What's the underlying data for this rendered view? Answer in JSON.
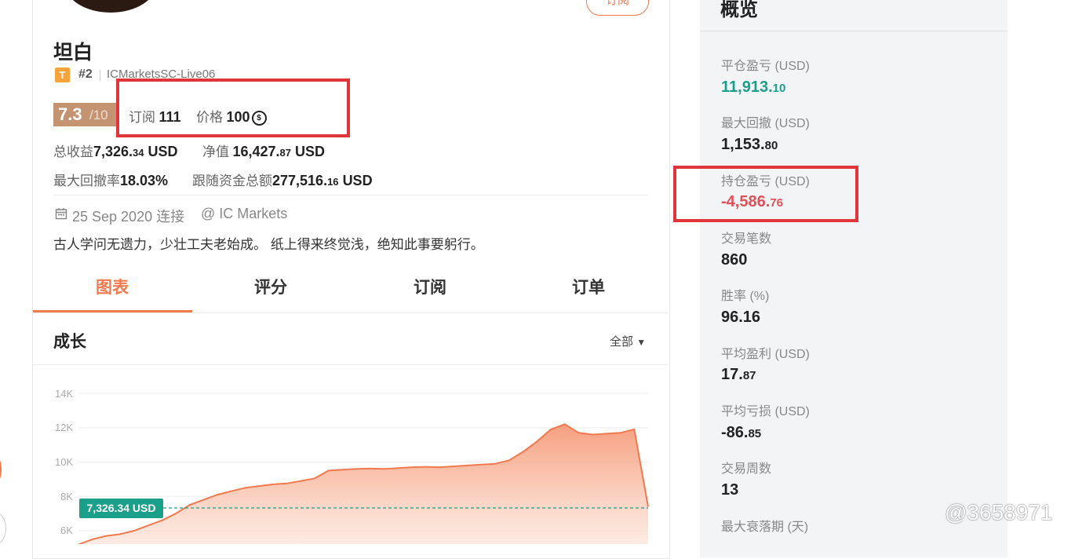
{
  "profile": {
    "subscribe_button": "订阅",
    "name": "坦白",
    "badge_letter": "T",
    "rank": "#2",
    "account": "ICMarketsSC-Live06",
    "score": "7.3",
    "score_max": "/10",
    "subscriptions_label": "订阅",
    "subscriptions_value": "111",
    "price_label": "价格",
    "price_value": "100",
    "coin_symbol": "$",
    "total_return_label": "总收益",
    "total_return_int": "7,326.",
    "total_return_dec": "34",
    "total_return_unit": "USD",
    "equity_label": "净值",
    "equity_int": "16,427.",
    "equity_dec": "87",
    "equity_unit": "USD",
    "max_dd_rate_label": "最大回撤率",
    "max_dd_rate_value": "18.03%",
    "follow_funds_label": "跟随资金总额",
    "follow_funds_int": "277,516.",
    "follow_funds_dec": "16",
    "follow_funds_unit": "USD",
    "connected_date": "25 Sep 2020 连接",
    "broker": "@ IC Markets",
    "bio": "古人学问无遗力，少壮工夫老始成。 纸上得来终觉浅，绝知此事要躬行。"
  },
  "tabs": [
    {
      "label": "图表",
      "active": true
    },
    {
      "label": "评分",
      "active": false
    },
    {
      "label": "订阅",
      "active": false
    },
    {
      "label": "订单",
      "active": false
    }
  ],
  "growth": {
    "title": "成长",
    "filter": "全部",
    "current_label": "7,326.34 USD"
  },
  "chart_data": {
    "type": "area",
    "title": "成长",
    "y_ticks": [
      "14K",
      "12K",
      "10K",
      "8K",
      "6K"
    ],
    "ylim": [
      5500,
      14000
    ],
    "reference_line": 7326.34,
    "x": [
      0,
      1,
      2,
      3,
      4,
      5,
      6,
      7,
      8,
      9,
      10,
      11,
      12,
      13,
      14,
      15,
      16,
      17,
      18,
      19,
      20,
      21,
      22,
      23,
      24,
      25,
      26,
      27,
      28,
      29,
      30,
      31,
      32,
      33,
      34,
      35,
      36,
      37,
      38,
      39,
      40,
      41
    ],
    "values": [
      5200,
      5500,
      5700,
      5800,
      6000,
      6300,
      6600,
      7000,
      7500,
      7800,
      8100,
      8300,
      8500,
      8600,
      8700,
      8750,
      8900,
      9050,
      9500,
      9550,
      9600,
      9620,
      9600,
      9650,
      9700,
      9720,
      9700,
      9750,
      9800,
      9850,
      9900,
      10100,
      10600,
      11200,
      11900,
      12200,
      11700,
      11600,
      11650,
      11700,
      11900,
      7400
    ],
    "colors": {
      "line": "#f07a4e",
      "fill_top": "#f69a78",
      "fill_bottom": "#fde6dc",
      "reference": "#1aa08a"
    }
  },
  "overview": {
    "title": "概览",
    "metrics": [
      {
        "label": "平仓盈亏 (USD)",
        "int": "11,913.",
        "dec": "10",
        "color": "#1aa08a"
      },
      {
        "label": "最大回撤 (USD)",
        "int": "1,153.",
        "dec": "80",
        "color": "#222222"
      },
      {
        "label": "持仓盈亏 (USD)",
        "int": "-4,586.",
        "dec": "76",
        "color": "#e0505a"
      },
      {
        "label": "交易笔数",
        "int": "860",
        "dec": "",
        "color": "#222222"
      },
      {
        "label": "胜率 (%)",
        "int": "96.16",
        "dec": "",
        "color": "#222222"
      },
      {
        "label": "平均盈利 (USD)",
        "int": "17.",
        "dec": "87",
        "color": "#222222"
      },
      {
        "label": "平均亏损 (USD)",
        "int": "-86.",
        "dec": "85",
        "color": "#222222"
      },
      {
        "label": "交易周数",
        "int": "13",
        "dec": "",
        "color": "#222222"
      },
      {
        "label": "最大衰落期 (天)",
        "int": "",
        "dec": "",
        "color": "#222222"
      }
    ]
  },
  "watermark": "@3658971"
}
